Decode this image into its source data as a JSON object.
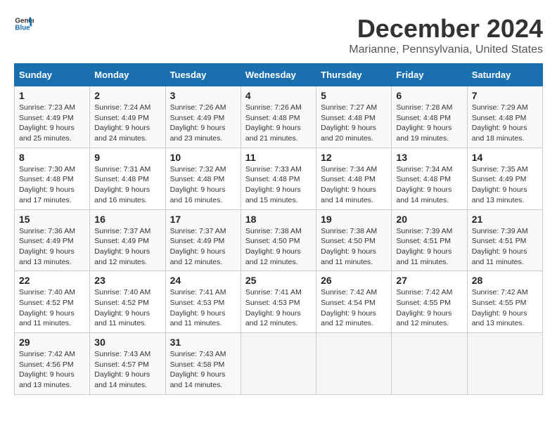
{
  "logo": {
    "line1": "General",
    "line2": "Blue"
  },
  "title": "December 2024",
  "subtitle": "Marianne, Pennsylvania, United States",
  "days_of_week": [
    "Sunday",
    "Monday",
    "Tuesday",
    "Wednesday",
    "Thursday",
    "Friday",
    "Saturday"
  ],
  "weeks": [
    [
      {
        "day": "1",
        "sunrise": "7:23 AM",
        "sunset": "4:49 PM",
        "daylight": "9 hours and 25 minutes."
      },
      {
        "day": "2",
        "sunrise": "7:24 AM",
        "sunset": "4:49 PM",
        "daylight": "9 hours and 24 minutes."
      },
      {
        "day": "3",
        "sunrise": "7:26 AM",
        "sunset": "4:49 PM",
        "daylight": "9 hours and 23 minutes."
      },
      {
        "day": "4",
        "sunrise": "7:26 AM",
        "sunset": "4:48 PM",
        "daylight": "9 hours and 21 minutes."
      },
      {
        "day": "5",
        "sunrise": "7:27 AM",
        "sunset": "4:48 PM",
        "daylight": "9 hours and 20 minutes."
      },
      {
        "day": "6",
        "sunrise": "7:28 AM",
        "sunset": "4:48 PM",
        "daylight": "9 hours and 19 minutes."
      },
      {
        "day": "7",
        "sunrise": "7:29 AM",
        "sunset": "4:48 PM",
        "daylight": "9 hours and 18 minutes."
      }
    ],
    [
      {
        "day": "8",
        "sunrise": "7:30 AM",
        "sunset": "4:48 PM",
        "daylight": "9 hours and 17 minutes."
      },
      {
        "day": "9",
        "sunrise": "7:31 AM",
        "sunset": "4:48 PM",
        "daylight": "9 hours and 16 minutes."
      },
      {
        "day": "10",
        "sunrise": "7:32 AM",
        "sunset": "4:48 PM",
        "daylight": "9 hours and 16 minutes."
      },
      {
        "day": "11",
        "sunrise": "7:33 AM",
        "sunset": "4:48 PM",
        "daylight": "9 hours and 15 minutes."
      },
      {
        "day": "12",
        "sunrise": "7:34 AM",
        "sunset": "4:48 PM",
        "daylight": "9 hours and 14 minutes."
      },
      {
        "day": "13",
        "sunrise": "7:34 AM",
        "sunset": "4:48 PM",
        "daylight": "9 hours and 14 minutes."
      },
      {
        "day": "14",
        "sunrise": "7:35 AM",
        "sunset": "4:49 PM",
        "daylight": "9 hours and 13 minutes."
      }
    ],
    [
      {
        "day": "15",
        "sunrise": "7:36 AM",
        "sunset": "4:49 PM",
        "daylight": "9 hours and 13 minutes."
      },
      {
        "day": "16",
        "sunrise": "7:37 AM",
        "sunset": "4:49 PM",
        "daylight": "9 hours and 12 minutes."
      },
      {
        "day": "17",
        "sunrise": "7:37 AM",
        "sunset": "4:49 PM",
        "daylight": "9 hours and 12 minutes."
      },
      {
        "day": "18",
        "sunrise": "7:38 AM",
        "sunset": "4:50 PM",
        "daylight": "9 hours and 12 minutes."
      },
      {
        "day": "19",
        "sunrise": "7:38 AM",
        "sunset": "4:50 PM",
        "daylight": "9 hours and 11 minutes."
      },
      {
        "day": "20",
        "sunrise": "7:39 AM",
        "sunset": "4:51 PM",
        "daylight": "9 hours and 11 minutes."
      },
      {
        "day": "21",
        "sunrise": "7:39 AM",
        "sunset": "4:51 PM",
        "daylight": "9 hours and 11 minutes."
      }
    ],
    [
      {
        "day": "22",
        "sunrise": "7:40 AM",
        "sunset": "4:52 PM",
        "daylight": "9 hours and 11 minutes."
      },
      {
        "day": "23",
        "sunrise": "7:40 AM",
        "sunset": "4:52 PM",
        "daylight": "9 hours and 11 minutes."
      },
      {
        "day": "24",
        "sunrise": "7:41 AM",
        "sunset": "4:53 PM",
        "daylight": "9 hours and 11 minutes."
      },
      {
        "day": "25",
        "sunrise": "7:41 AM",
        "sunset": "4:53 PM",
        "daylight": "9 hours and 12 minutes."
      },
      {
        "day": "26",
        "sunrise": "7:42 AM",
        "sunset": "4:54 PM",
        "daylight": "9 hours and 12 minutes."
      },
      {
        "day": "27",
        "sunrise": "7:42 AM",
        "sunset": "4:55 PM",
        "daylight": "9 hours and 12 minutes."
      },
      {
        "day": "28",
        "sunrise": "7:42 AM",
        "sunset": "4:55 PM",
        "daylight": "9 hours and 13 minutes."
      }
    ],
    [
      {
        "day": "29",
        "sunrise": "7:42 AM",
        "sunset": "4:56 PM",
        "daylight": "9 hours and 13 minutes."
      },
      {
        "day": "30",
        "sunrise": "7:43 AM",
        "sunset": "4:57 PM",
        "daylight": "9 hours and 14 minutes."
      },
      {
        "day": "31",
        "sunrise": "7:43 AM",
        "sunset": "4:58 PM",
        "daylight": "9 hours and 14 minutes."
      },
      null,
      null,
      null,
      null
    ]
  ],
  "labels": {
    "sunrise": "Sunrise:",
    "sunset": "Sunset:",
    "daylight": "Daylight:"
  }
}
